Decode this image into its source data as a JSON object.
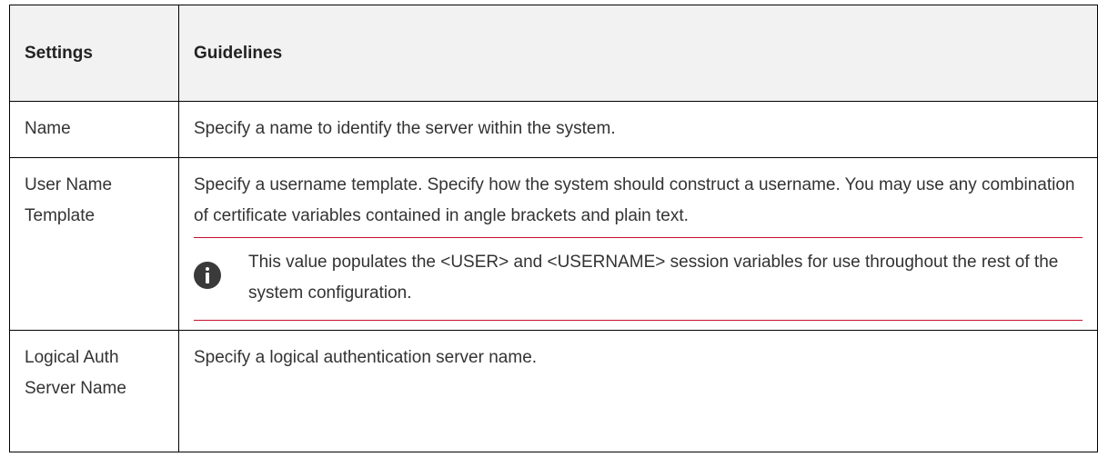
{
  "table": {
    "headers": {
      "settings": "Settings",
      "guidelines": "Guidelines"
    },
    "rows": [
      {
        "setting": "Name",
        "guideline": "Specify a name to identify the server within the system."
      },
      {
        "setting": "User Name Template",
        "guideline": "Specify a username template. Specify how the system should construct a username. You may use any combination of certificate variables contained in angle brackets and plain text.",
        "note": {
          "icon": "info-icon",
          "text": "This value populates the <USER> and <USERNAME> session variables for use throughout the rest of the system configuration."
        }
      },
      {
        "setting": "Logical Auth Server Name",
        "guideline": "Specify a logical authentication server name."
      }
    ]
  },
  "colors": {
    "header_background": "#f2f2f2",
    "note_rule": "#c8102e",
    "icon_background": "#3a3a3a"
  }
}
